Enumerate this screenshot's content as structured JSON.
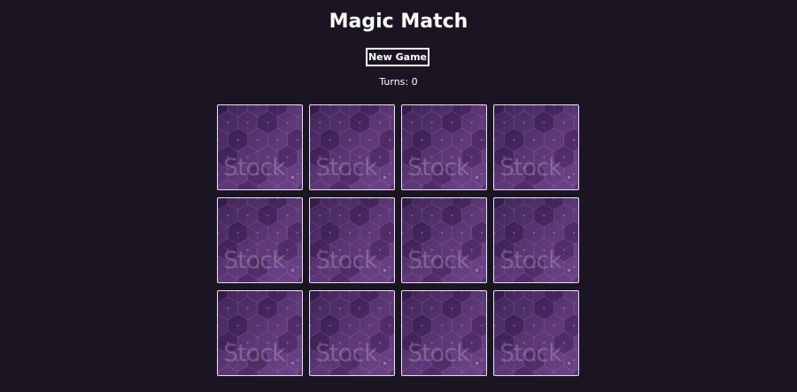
{
  "header": {
    "title": "Magic Match"
  },
  "controls": {
    "new_game_label": "New Game",
    "turns_text": "Turns: 0"
  },
  "board": {
    "card_back_watermark": "Stock",
    "card_count": 12,
    "columns": 4,
    "rows": 3
  },
  "colors": {
    "background": "#1b1523",
    "card_back": "#5d3478",
    "text": "#ffffff"
  }
}
